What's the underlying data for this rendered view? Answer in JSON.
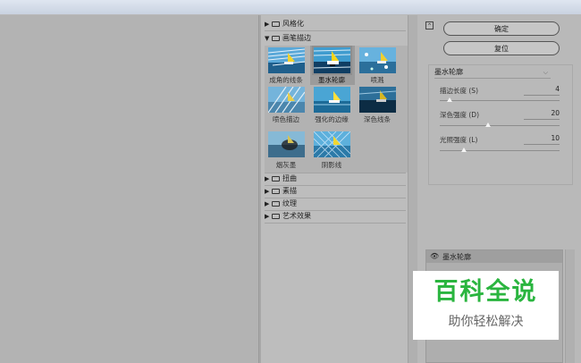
{
  "filter_gallery": {
    "categories_closed_top": [
      {
        "label": "风格化"
      }
    ],
    "open_category": {
      "label": "画笔描边",
      "filters": [
        {
          "label": "成角的线条",
          "selected": false
        },
        {
          "label": "墨水轮廓",
          "selected": true
        },
        {
          "label": "喷溅",
          "selected": false
        },
        {
          "label": "喷色描边",
          "selected": false
        },
        {
          "label": "强化的边缘",
          "selected": false
        },
        {
          "label": "深色线条",
          "selected": false
        },
        {
          "label": "烟灰墨",
          "selected": false
        },
        {
          "label": "阴影线",
          "selected": false
        }
      ]
    },
    "categories_closed_bottom": [
      {
        "label": "扭曲"
      },
      {
        "label": "素描"
      },
      {
        "label": "纹理"
      },
      {
        "label": "艺术效果"
      }
    ]
  },
  "buttons": {
    "ok": "确定",
    "reset": "复位"
  },
  "settings": {
    "selected_filter": "墨水轮廓",
    "params": [
      {
        "label": "描边长度 (S)",
        "value": "4",
        "slider_fraction": 0.08
      },
      {
        "label": "深色强度 (D)",
        "value": "20",
        "slider_fraction": 0.4
      },
      {
        "label": "光照强度 (L)",
        "value": "10",
        "slider_fraction": 0.2
      }
    ]
  },
  "layers": {
    "items": [
      {
        "label": "墨水轮廓",
        "visible": true
      }
    ]
  },
  "watermark": {
    "line1": "百科全说",
    "line2": "助你轻松解决"
  },
  "colors": {
    "watermark_green": "#2ab53f",
    "background": "#b9b9b9"
  }
}
